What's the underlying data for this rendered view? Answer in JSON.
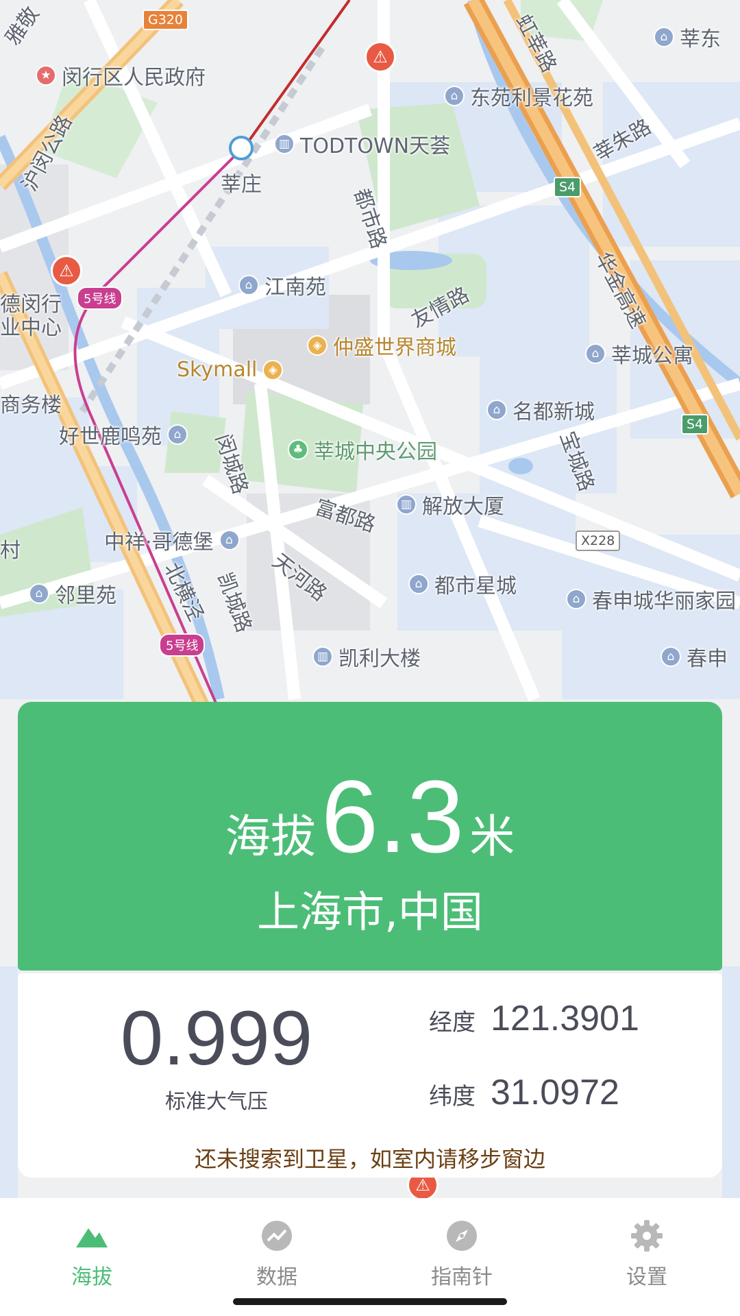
{
  "map": {
    "labels": {
      "yajing": "雅敬",
      "minhang_gov": "闵行区人民政府",
      "hu_min_rd": "沪闵公路",
      "todtown": "TODTOWN天荟",
      "xinzhuang": "莘庄",
      "dongyuan": "东苑利景花苑",
      "hongxin_rd": "虹莘路",
      "xinzhu_rd": "莘朱路",
      "xindong": "莘东",
      "dushi_rd": "都市路",
      "jiangnan": "江南苑",
      "youqing_rd": "友情路",
      "zhongsheng": "仲盛世界商城",
      "skymall": "Skymall",
      "xincheng_apt": "莘城公寓",
      "huajin": "华金高速",
      "mingdu": "名都新城",
      "haoshi": "好世鹿鸣苑",
      "xincheng_park": "莘城中央公园",
      "baocheng_rd": "宝城路",
      "mincheng_rd": "闵城路",
      "fudu_rd": "富都路",
      "jiefang": "解放大厦",
      "zhongxiang": "中祥·哥德堡",
      "tianhe_rd": "天河路",
      "dushi_xing": "都市星城",
      "chunshen": "春申城华丽家园",
      "linliyuan": "邻里苑",
      "beihengjing": "北横泾",
      "kaicheng_rd": "凯城路",
      "kaili": "凯利大楼",
      "chunshen2": "春申",
      "minxing_center": "德闵行\n业中心",
      "business": "商务楼",
      "village": "村"
    },
    "shields": {
      "g320": "G320",
      "s4a": "S4",
      "s4b": "S4",
      "x228": "X228",
      "line5a": "5号线",
      "line5b": "5号线"
    }
  },
  "altitude": {
    "label": "海拔",
    "value": "6.3",
    "unit": "米",
    "location": "上海市,中国"
  },
  "info": {
    "pressure_value": "0.999",
    "pressure_label": "标准大气压",
    "longitude_label": "经度",
    "longitude_value": "121.3901",
    "latitude_label": "纬度",
    "latitude_value": "31.0972",
    "gps_note": "还未搜索到卫星，如室内请移步窗边"
  },
  "tabs": {
    "altitude": "海拔",
    "data": "数据",
    "compass": "指南针",
    "settings": "设置",
    "active": "altitude"
  },
  "colors": {
    "accent": "#4cbd77",
    "gps_note": "#6a3f12",
    "metro_line": "#c93e8f"
  },
  "icons": {
    "altitude": "mountain-icon",
    "data": "chart-trend-icon",
    "compass": "compass-icon",
    "settings": "gear-icon"
  }
}
